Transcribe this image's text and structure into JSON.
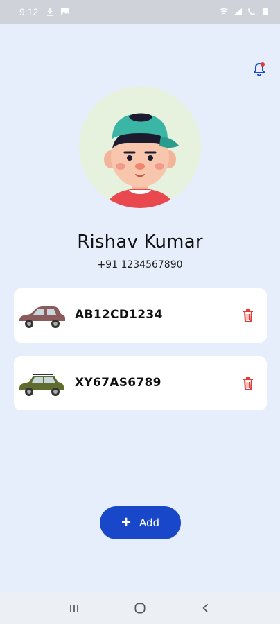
{
  "status_bar": {
    "time": "9:12",
    "left_icons": [
      "download-icon",
      "image-icon"
    ],
    "right_icons": [
      "wifi-icon",
      "signal-icon",
      "call-icon",
      "battery-icon"
    ]
  },
  "header": {
    "bell_icon": "notification-bell-icon",
    "bell_dot_color": "#e53935"
  },
  "profile": {
    "name": "Rishav Kumar",
    "phone": "+91 1234567890",
    "avatar_icon": "user-avatar-illustration"
  },
  "vehicles": [
    {
      "plate": "AB12CD1234",
      "car_color": "#8b5a5a",
      "icon": "sedan-car-icon"
    },
    {
      "plate": "XY67AS6789",
      "car_color": "#5f6b2f",
      "icon": "suv-car-icon"
    }
  ],
  "actions": {
    "add_label": "Add",
    "add_icon": "plus-icon"
  },
  "colors": {
    "background": "#e6eefc",
    "primary": "#1848c9",
    "danger": "#e53935"
  },
  "navbar": {
    "items": [
      "recent-apps-icon",
      "home-icon",
      "back-icon"
    ]
  }
}
